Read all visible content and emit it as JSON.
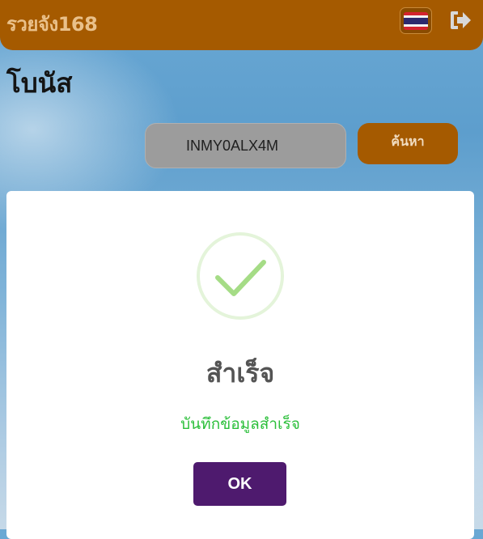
{
  "header": {
    "brand": "รวยจัง168",
    "language_icon": "thailand-flag-icon",
    "logout_icon": "logout-icon"
  },
  "page": {
    "title": "โบนัส"
  },
  "search": {
    "value": "INMY0ALX4M",
    "button_label": "ค้นหา"
  },
  "dialog": {
    "icon": "success-check-icon",
    "title": "สำเร็จ",
    "message": "บันทึกข้อมูลสำเร็จ",
    "ok_label": "OK"
  },
  "colors": {
    "header_bg": "#a55a00",
    "ok_button_bg": "#4e1a6e",
    "success_green": "#2bbf3a",
    "check_green": "#a5dc86"
  }
}
